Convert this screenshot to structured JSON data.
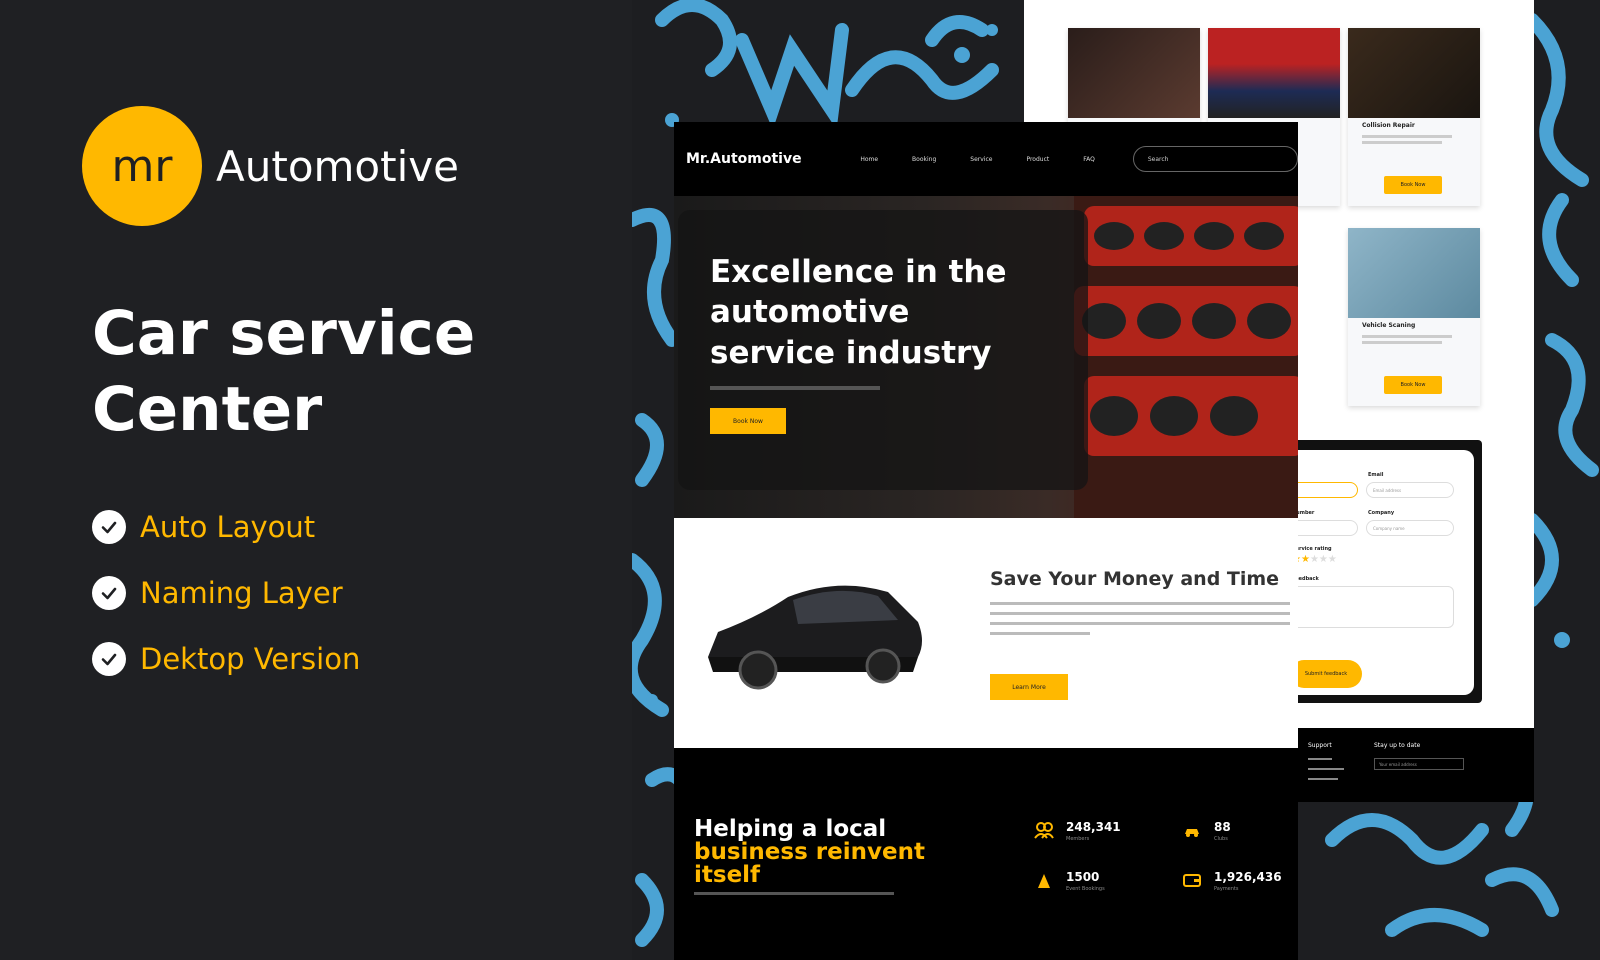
{
  "brand": {
    "logo_initials": "mr",
    "name": "Automotive"
  },
  "headline": "Car service Center",
  "features": [
    {
      "label": "Auto Layout"
    },
    {
      "label": "Naming Layer"
    },
    {
      "label": "Dektop Version"
    }
  ],
  "colors": {
    "accent": "#ffb800",
    "background": "#1f2023",
    "doodle": "#4ba3d4"
  },
  "mockup": {
    "nav": {
      "logo": "Mr.Automotive",
      "items": [
        "Home",
        "Booking",
        "Service",
        "Product",
        "FAQ"
      ],
      "search_placeholder": "Search"
    },
    "hero": {
      "title": "Excellence in the automotive service industry",
      "button": "Book Now"
    },
    "save_section": {
      "title": "Save Your Money and Time",
      "button": "Learn More"
    },
    "stats_section": {
      "title_line1": "Helping a local",
      "title_line2": "business reinvent",
      "title_line3": "itself",
      "stats": [
        {
          "number": "248,341",
          "label": "Members",
          "icon": "users-icon"
        },
        {
          "number": "88",
          "label": "Clubs",
          "icon": "car-icon"
        },
        {
          "number": "1500",
          "label": "Event Bookings",
          "icon": "trophy-icon"
        },
        {
          "number": "1,926,436",
          "label": "Payments",
          "icon": "wallet-icon"
        }
      ]
    }
  },
  "back_page": {
    "services": [
      {
        "title": "",
        "button": ""
      },
      {
        "title": "",
        "button": ""
      },
      {
        "title": "Collision Repair",
        "button": "Book Now"
      },
      {
        "title": "",
        "button": ""
      },
      {
        "title": "Vehicle Scaning",
        "button": "Book Now"
      }
    ],
    "form": {
      "email_label": "Email",
      "email_placeholder": "Email address",
      "company_label": "Company",
      "company_placeholder": "Company name",
      "number_label": "Number",
      "rating_label": "Service rating",
      "feedback_label": "Feedback",
      "submit": "Submit feedback"
    },
    "footer": {
      "support_title": "Support",
      "newsletter_title": "Stay up to date",
      "newsletter_placeholder": "Your email address"
    }
  }
}
